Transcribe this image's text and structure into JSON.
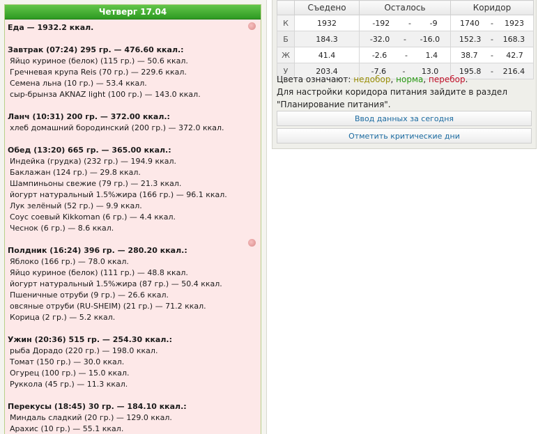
{
  "day": {
    "title": "Четверг 17.04",
    "total": "Еда — 1932.2 ккал.",
    "meals": [
      {
        "head": "Завтрак (07:24) 295 гр. — 476.60 ккал.:",
        "items": [
          "Яйцо куриное (белок) (115 гр.) — 50.6 ккал.",
          "Гречневая крупа Reis (70 гр.) — 229.6 ккал.",
          "Семена льна (10 гр.) — 53.4 ккал.",
          "сыр-брынза AKNAZ light (100 гр.) — 143.0 ккал."
        ]
      },
      {
        "head": "Ланч (10:31) 200 гр. — 372.00 ккал.:",
        "items": [
          "хлеб домашний бородинский (200 гр.) — 372.0 ккал."
        ]
      },
      {
        "head": "Обед (13:20) 665 гр. — 365.00 ккал.:",
        "items": [
          "Индейка (грудка) (232 гр.) — 194.9 ккал.",
          "Баклажан (124 гр.) — 29.8 ккал.",
          "Шампиньоны свежие (79 гр.) — 21.3 ккал.",
          "йогурт натуральный 1.5%жира (166 гр.) — 96.1 ккал.",
          "Лук зелёный (52 гр.) — 9.9 ккал.",
          "Соус соевый Kikkoman (6 гр.) — 4.4 ккал.",
          "Чеснок (6 гр.) — 8.6 ккал."
        ]
      },
      {
        "head": "Полдник (16:24) 396 гр. — 280.20 ккал.:",
        "items": [
          "Яблоко (166 гр.) — 78.0 ккал.",
          "Яйцо куриное (белок) (111 гр.) — 48.8 ккал.",
          "йогурт натуральный 1.5%жира (87 гр.) — 50.4 ккал.",
          "Пшеничные отруби (9 гр.) — 26.6 ккал.",
          "овсяные отруби (RU-SHEIM) (21 гр.) — 71.2 ккал.",
          "Корица (2 гр.) — 5.2 ккал."
        ]
      },
      {
        "head": "Ужин (20:36) 515 гр. — 254.30 ккал.:",
        "items": [
          "рыба Дорадо (220 гр.) — 198.0 ккал.",
          "Томат (150 гр.) — 30.0 ккал.",
          "Огурец (100 гр.) — 15.0 ккал.",
          "Руккола (45 гр.) — 11.3 ккал."
        ]
      },
      {
        "head": "Перекусы (18:45) 30 гр. — 184.10 ккал.:",
        "items": [
          "Миндаль сладкий (20 гр.) — 129.0 ккал.",
          "Арахис (10 гр.) — 55.1 ккал."
        ]
      }
    ]
  },
  "stats": {
    "headers": [
      "Съедено",
      "Осталось",
      "Коридор"
    ],
    "sep": "-",
    "rows": [
      {
        "label": "К",
        "eaten": "1932",
        "left_a": "-192",
        "left_b": "-9",
        "cor_a": "1740",
        "cor_b": "1923",
        "status": "over"
      },
      {
        "label": "Б",
        "eaten": "184.3",
        "left_a": "-32.0",
        "left_b": "-16.0",
        "cor_a": "152.3",
        "cor_b": "168.3",
        "status": "over"
      },
      {
        "label": "Ж",
        "eaten": "41.4",
        "left_a": "-2.6",
        "left_b": "1.4",
        "cor_a": "38.7",
        "cor_b": "42.7",
        "status": "ok"
      },
      {
        "label": "У",
        "eaten": "203.4",
        "left_a": "-7.6",
        "left_b": "13.0",
        "cor_a": "195.8",
        "cor_b": "216.4",
        "status": "ok"
      }
    ]
  },
  "legend": {
    "prefix": "Цвета означают:",
    "under": "недобор",
    "norm": "норма",
    "over": "перебор",
    "comma": ",",
    "dot": ".",
    "line2": "Для настройки коридора питания зайдите в раздел",
    "line3": "\"Планирование питания\"."
  },
  "buttons": {
    "enter_today": "Ввод данных за сегодня",
    "critical_days": "Отметить критические дни"
  },
  "colors": {
    "header_green": "#2e9a22",
    "over": "#c0112a",
    "ok": "#2a9a16",
    "under": "#9a8f0a",
    "panel_pink": "#fde8e8"
  }
}
